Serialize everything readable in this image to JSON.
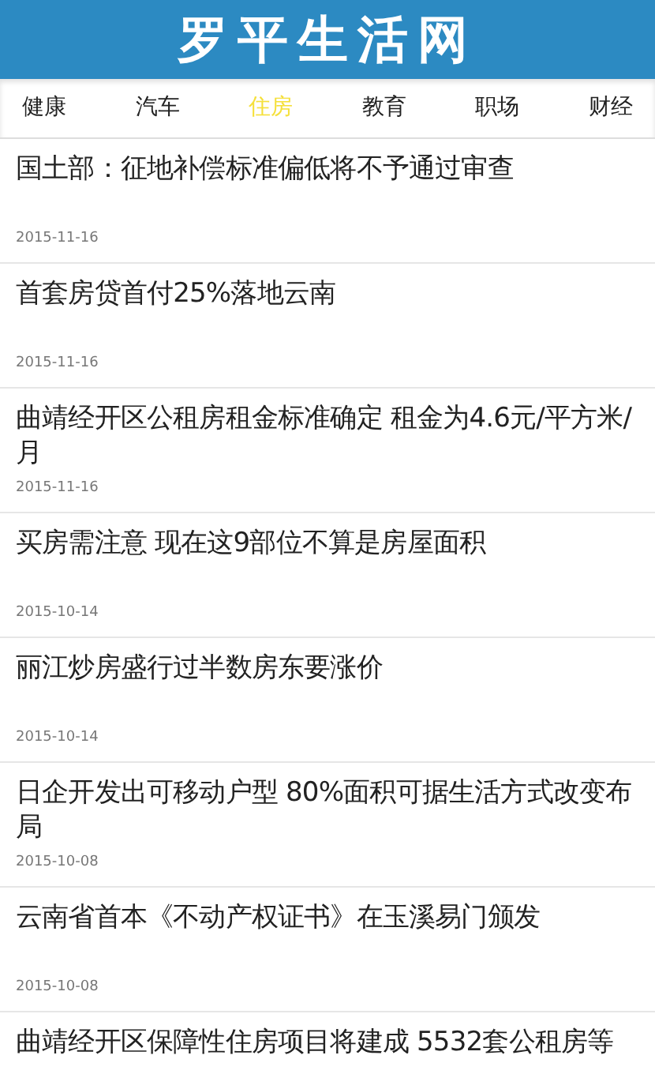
{
  "header": {
    "title": "罗平生活网"
  },
  "tabs": [
    {
      "label": "健康",
      "selected": false
    },
    {
      "label": "汽车",
      "selected": false
    },
    {
      "label": "住房",
      "selected": true
    },
    {
      "label": "教育",
      "selected": false
    },
    {
      "label": "职场",
      "selected": false
    },
    {
      "label": "财经",
      "selected": false
    }
  ],
  "articles": [
    {
      "title": "国土部：征地补偿标准偏低将不予通过审查",
      "date": "2015-11-16"
    },
    {
      "title": "首套房贷首付25%落地云南",
      "date": "2015-11-16"
    },
    {
      "title": "曲靖经开区公租房租金标准确定 租金为4.6元/平方米/月",
      "date": "2015-11-16"
    },
    {
      "title": "买房需注意 现在这9部位不算是房屋面积",
      "date": "2015-10-14"
    },
    {
      "title": "丽江炒房盛行过半数房东要涨价",
      "date": "2015-10-14"
    },
    {
      "title": "日企开发出可移动户型 80%面积可据生活方式改变布局",
      "date": "2015-10-08"
    },
    {
      "title": "云南省首本《不动产权证书》在玉溪易门颁发",
      "date": "2015-10-08"
    },
    {
      "title": "曲靖经开区保障性住房项目将建成 5532套公租房等"
    }
  ]
}
